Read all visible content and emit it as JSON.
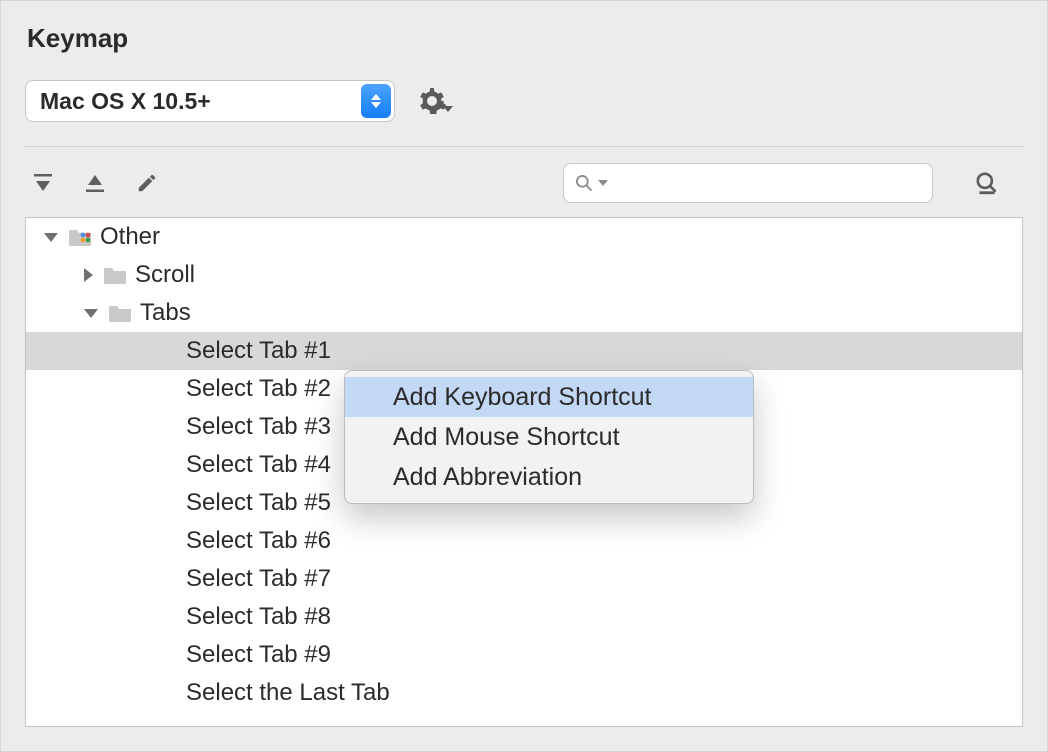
{
  "title": "Keymap",
  "scheme": {
    "selected": "Mac OS X 10.5+"
  },
  "search": {
    "value": ""
  },
  "tree": {
    "root": {
      "label": "Other"
    },
    "scroll": {
      "label": "Scroll"
    },
    "tabs_group": {
      "label": "Tabs"
    },
    "items": [
      {
        "label": "Select Tab #1"
      },
      {
        "label": "Select Tab #2"
      },
      {
        "label": "Select Tab #3"
      },
      {
        "label": "Select Tab #4"
      },
      {
        "label": "Select Tab #5"
      },
      {
        "label": "Select Tab #6"
      },
      {
        "label": "Select Tab #7"
      },
      {
        "label": "Select Tab #8"
      },
      {
        "label": "Select Tab #9"
      },
      {
        "label": "Select the Last Tab"
      }
    ]
  },
  "context_menu": {
    "items": [
      {
        "label": "Add Keyboard Shortcut"
      },
      {
        "label": "Add Mouse Shortcut"
      },
      {
        "label": "Add Abbreviation"
      }
    ]
  }
}
